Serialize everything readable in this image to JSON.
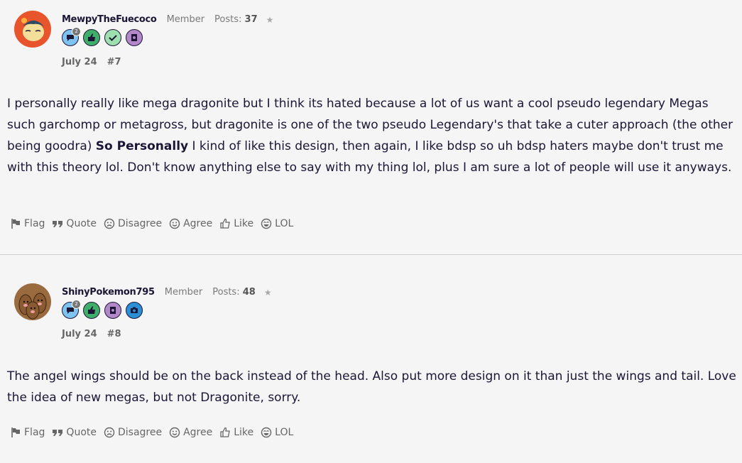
{
  "posts": [
    {
      "username": "MewpyTheFuecoco",
      "role": "Member",
      "posts_label": "Posts:",
      "posts_count": "37",
      "star": "★",
      "badges": [
        "comment-badge-icon",
        "thumbs-up-badge-icon",
        "check-badge-icon",
        "notebook-badge-icon"
      ],
      "badge_count": "2",
      "date": "July 24",
      "post_number": "#7",
      "body_part1": "I personally really like mega dragonite but I think its hated because a lot of us want a cool pseudo legendary Megas such garchomp or metagross, but dragonite is one of the two pseudo Legendary's that take a cuter approach (the other being goodra) ",
      "body_bold": "So Personally",
      "body_part2": " I kind of like this design, then again, I like bdsp so uh bdsp haters maybe don't trust me with this theory lol. Don't know anything else to say with my thing lol, plus I am sure a lot of people will use it anyways."
    },
    {
      "username": "ShinyPokemon795",
      "role": "Member",
      "posts_label": "Posts:",
      "posts_count": "48",
      "star": "★",
      "badges": [
        "comment-badge-icon",
        "thumbs-up-badge-icon",
        "notebook-badge-icon",
        "camera-badge-icon"
      ],
      "badge_count": "2",
      "date": "July 24",
      "post_number": "#8",
      "body": "The angel wings should be on the back instead of the head. Also put more design on it than just the wings and tail. Love the idea of new megas, but not Dragonite, sorry."
    }
  ],
  "actions": {
    "flag": "Flag",
    "quote": "Quote",
    "disagree": "Disagree",
    "agree": "Agree",
    "like": "Like",
    "lol": "LOL"
  },
  "colors": {
    "background": "#f5f5f5",
    "text": "#1c1636",
    "muted": "#666666",
    "badge_blue": "#7fc3f0",
    "badge_green": "#3fae6a",
    "badge_lightgreen": "#9fe0b0",
    "badge_purple": "#b388c8",
    "badge_camera": "#2b8fd6"
  }
}
